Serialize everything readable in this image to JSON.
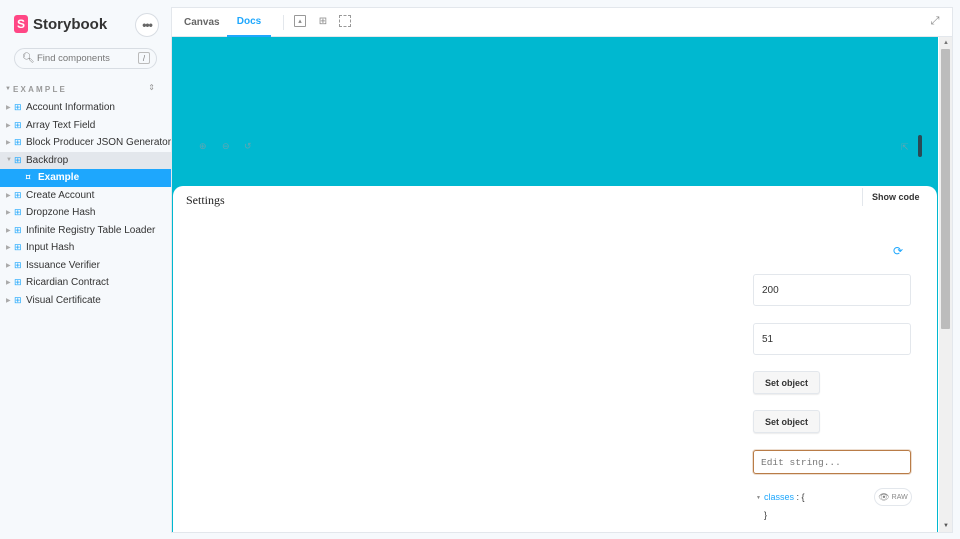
{
  "app": {
    "logo_letter": "S",
    "name": "Storybook",
    "menu_glyph": "•••"
  },
  "search": {
    "placeholder": "Find components",
    "shortcut": "/"
  },
  "sidebar": {
    "section_title": "EXAMPLE",
    "items": [
      {
        "label": "Account Information"
      },
      {
        "label": "Array Text Field"
      },
      {
        "label": "Block Producer JSON Generator"
      },
      {
        "label": "Backdrop",
        "expanded": true
      },
      {
        "label": "Example",
        "selected": true
      },
      {
        "label": "Create Account"
      },
      {
        "label": "Dropzone Hash"
      },
      {
        "label": "Infinite Registry Table Loader"
      },
      {
        "label": "Input Hash"
      },
      {
        "label": "Issuance Verifier"
      },
      {
        "label": "Ricardian Contract"
      },
      {
        "label": "Visual Certificate"
      }
    ]
  },
  "toolbar": {
    "tabs": [
      {
        "label": "Canvas"
      },
      {
        "label": "Docs",
        "active": true
      }
    ]
  },
  "canvas": {
    "background": "#00b8d0"
  },
  "panel": {
    "title": "Settings",
    "show_code": "Show code",
    "fields": [
      {
        "value": "200"
      },
      {
        "value": "51"
      }
    ],
    "buttons": [
      {
        "label": "Set object"
      },
      {
        "label": "Set object"
      }
    ],
    "string_placeholder": "Edit string...",
    "json": {
      "key": "classes",
      "sep": " : ",
      "open": "{",
      "close": "}"
    },
    "raw_label": "RAW"
  },
  "colors": {
    "accent": "#1ea7fd",
    "brand": "#ff4785"
  }
}
